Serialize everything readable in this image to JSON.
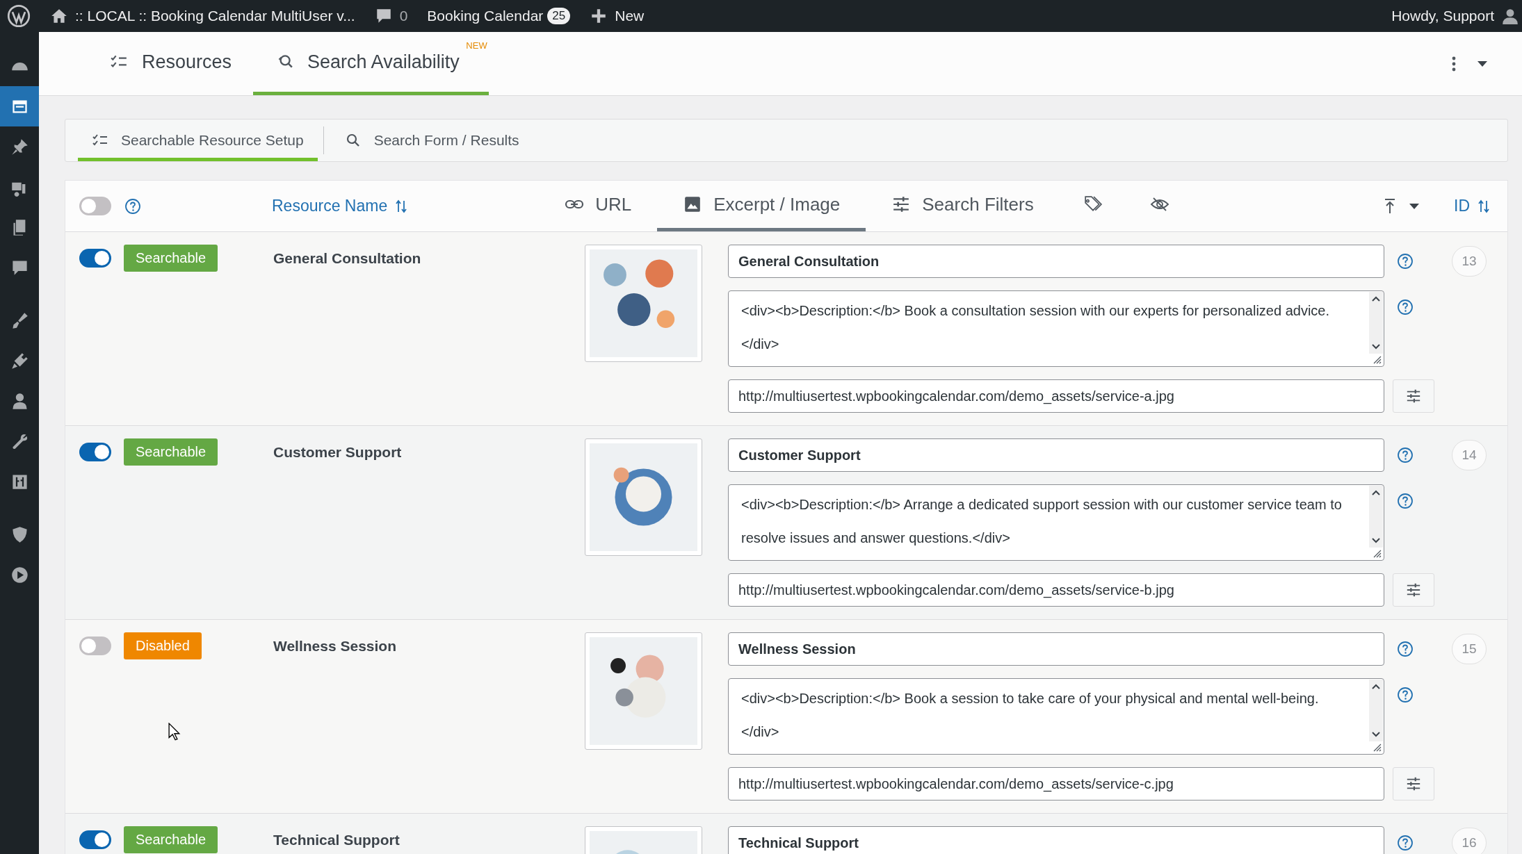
{
  "admin_bar": {
    "site_title": ":: LOCAL :: Booking Calendar MultiUser v...",
    "comments_count": "0",
    "plugin": "Booking Calendar",
    "plugin_badge": "25",
    "new_label": "New",
    "greeting": "Howdy, Support"
  },
  "sidebar": {
    "items": [
      {
        "selected": false
      },
      {
        "selected": true
      },
      {
        "selected": false
      },
      {
        "selected": false
      },
      {
        "selected": false
      },
      {
        "selected": false
      },
      {
        "selected": false
      },
      {
        "selected": false
      },
      {
        "selected": false
      },
      {
        "selected": false
      },
      {
        "selected": false
      },
      {
        "selected": false
      },
      {
        "selected": false
      }
    ]
  },
  "tabs": [
    {
      "label": "Resources",
      "selected": false
    },
    {
      "label": "Search Availability",
      "selected": true,
      "badge": "NEW"
    }
  ],
  "subtabs": [
    {
      "label": "Searchable Resource Setup",
      "selected": true
    },
    {
      "label": "Search Form / Results",
      "selected": false
    }
  ],
  "table": {
    "select_all_on": false,
    "name_column": "Resource Name",
    "id_column": "ID",
    "column_tabs": [
      {
        "label": "URL",
        "selected": false
      },
      {
        "label": "Excerpt / Image",
        "selected": true
      },
      {
        "label": "Search Filters",
        "selected": false
      },
      {
        "selected": false
      },
      {
        "selected": false
      }
    ],
    "rows": [
      {
        "on": true,
        "status": "Searchable",
        "name": "General Consultation",
        "title": "General Consultation",
        "description": "<div><b>Description:</b> Book a consultation session with our experts for personalized advice.</div>",
        "image_url": "http://multiusertest.wpbookingcalendar.com/demo_assets/service-a.jpg",
        "id": "13"
      },
      {
        "on": true,
        "status": "Searchable",
        "name": "Customer Support",
        "title": "Customer Support",
        "description": "<div><b>Description:</b> Arrange a dedicated support session with our customer service team to resolve issues and answer questions.</div>",
        "image_url": "http://multiusertest.wpbookingcalendar.com/demo_assets/service-b.jpg",
        "id": "14"
      },
      {
        "on": false,
        "status": "Disabled",
        "name": "Wellness Session",
        "title": "Wellness Session",
        "description": "<div><b>Description:</b> Book a session to take care of your physical and mental well-being.</div>",
        "image_url": "http://multiusertest.wpbookingcalendar.com/demo_assets/service-c.jpg",
        "id": "15"
      },
      {
        "on": true,
        "status": "Searchable",
        "name": "Technical Support",
        "title": "Technical Support",
        "id": "16"
      }
    ]
  }
}
